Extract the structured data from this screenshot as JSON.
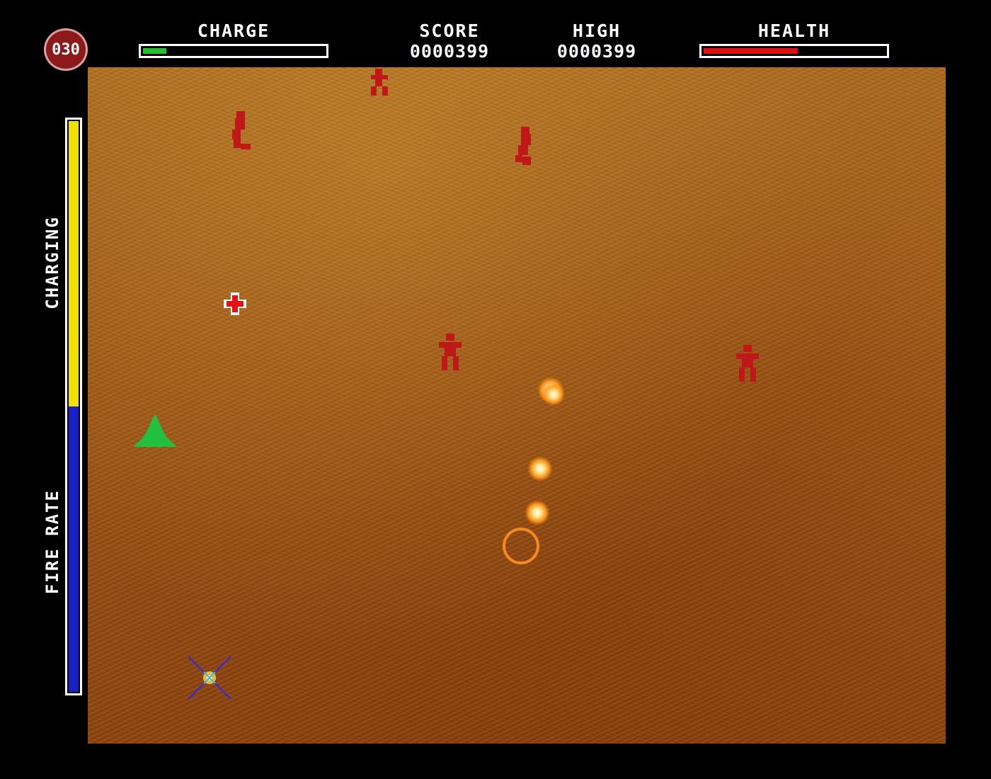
{
  "hud": {
    "counter": "030",
    "charge": {
      "label": "CHARGE",
      "level": 0.13,
      "color": "#22c02a"
    },
    "score": {
      "label": "SCORE",
      "value": "0000399"
    },
    "high": {
      "label": "HIGH",
      "value": "0000399"
    },
    "health": {
      "label": "HEALTH",
      "level": 0.52,
      "color": "#e01010"
    }
  },
  "side_meter": {
    "top_label": "CHARGING",
    "bottom_label": "FIRE RATE",
    "top_level": 0.5,
    "top_color": "#f0e000",
    "bottom_color": "#1820c8"
  },
  "playfield": {
    "enemies": [
      {
        "name": "enemy-soldier-top-center",
        "color": "#c01818",
        "pose": "walking"
      },
      {
        "name": "enemy-soldier-top-left",
        "color": "#c01818",
        "pose": "side"
      },
      {
        "name": "enemy-soldier-top-right",
        "color": "#c01818",
        "pose": "side"
      },
      {
        "name": "enemy-soldier-middle",
        "color": "#c01818",
        "pose": "walking"
      },
      {
        "name": "enemy-soldier-right",
        "color": "#c01818",
        "pose": "walking"
      }
    ],
    "pickup": {
      "name": "health-cross-pickup",
      "color": "#e81010"
    },
    "player": {
      "name": "player-ship",
      "color": "#22c040"
    },
    "projectiles": [
      {
        "name": "plasma-shot-1"
      },
      {
        "name": "plasma-shot-2"
      },
      {
        "name": "plasma-shot-3"
      },
      {
        "name": "plasma-shot-4"
      }
    ],
    "target_ring": {
      "name": "target-ring",
      "color": "#ff9020"
    },
    "crosshair": {
      "name": "crosshair-cursor",
      "color": "#3a30c8"
    }
  }
}
